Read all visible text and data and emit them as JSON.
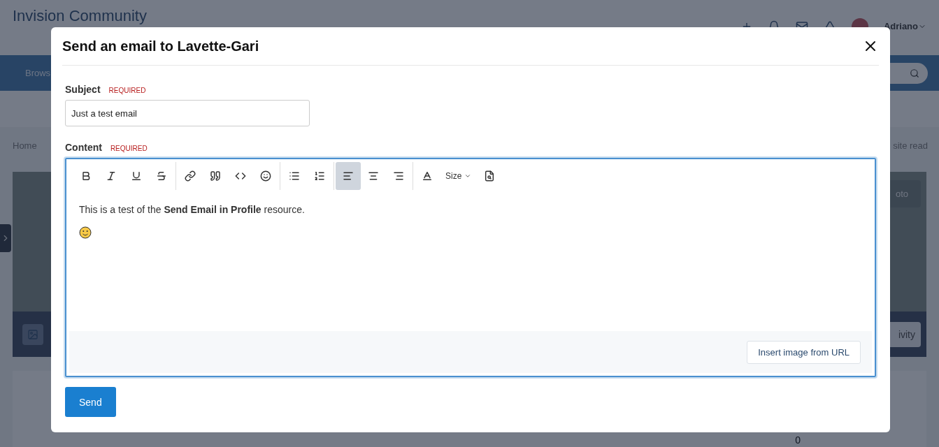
{
  "page": {
    "site_title": "Invision Community",
    "user": "Adriano",
    "nav_item": "Brows",
    "breadcrumb": "Home",
    "mark_read": "site read",
    "cover_button": "oto",
    "activity_button": "ivity",
    "count": "0"
  },
  "modal": {
    "title": "Send an email to Lavette-Gari",
    "fields": [
      {
        "label": "Subject",
        "required": "REQUIRED",
        "value": "Just a test email"
      }
    ],
    "content": {
      "label": "Content",
      "required": "REQUIRED",
      "toolbar": [
        [
          {
            "kind": "bold",
            "selected": false
          },
          {
            "kind": "italic",
            "selected": false
          },
          {
            "kind": "underline",
            "selected": false
          },
          {
            "kind": "strike",
            "selected": false
          }
        ],
        [
          {
            "kind": "link",
            "selected": false
          },
          {
            "kind": "quote",
            "selected": false
          },
          {
            "kind": "code",
            "selected": false
          },
          {
            "kind": "emoji",
            "selected": false
          }
        ],
        [
          {
            "kind": "bullets",
            "selected": false
          },
          {
            "kind": "numbers",
            "selected": false
          }
        ],
        [
          {
            "kind": "align-left",
            "selected": true
          },
          {
            "kind": "align-center",
            "selected": false
          },
          {
            "kind": "align-right",
            "selected": false
          }
        ],
        [
          {
            "kind": "color",
            "selected": false
          },
          {
            "kind": "size",
            "label": "Size",
            "selected": false
          },
          {
            "kind": "preview",
            "selected": false
          }
        ]
      ],
      "body": [
        {
          "kind": "text",
          "text": "This is a test of the **Send Email in Profile** resource."
        },
        {
          "kind": "emoji"
        }
      ],
      "insert_button": "Insert image from URL"
    },
    "send_button": "Send"
  }
}
